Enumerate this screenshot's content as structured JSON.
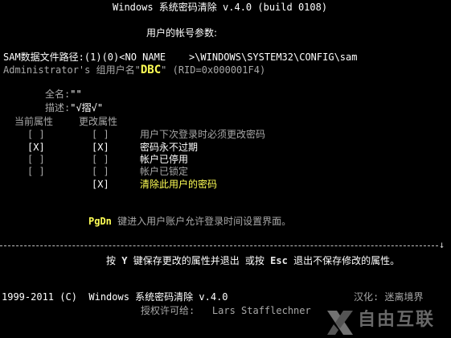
{
  "header": {
    "title": "Windows 系统密码清除 v.4.0 (build 0108)",
    "subtitle": "用户的帐号参数:"
  },
  "sam": {
    "label": "SAM数据文件路径:",
    "value": "(1)(0)<NO NAME    >\\WINDOWS\\SYSTEM32\\CONFIG\\sam"
  },
  "user": {
    "account": "Administrator's",
    "group_label": "组用户名\"",
    "group_name": "DBC",
    "rid": "\" (RID=0x000001F4)"
  },
  "fields": {
    "fullname_label": "全名:",
    "fullname_value": "\"\"",
    "desc_label": "描述:",
    "desc_value": "\"√摺√\""
  },
  "columns": {
    "current": "当前属性",
    "change": "更改属性"
  },
  "attributes": [
    {
      "current": "[ ]",
      "change": "[ ]",
      "label": "用户下次登录时必须更改密码",
      "style": "gray"
    },
    {
      "current": "[X]",
      "change": "[X]",
      "label": "密码永不过期",
      "style": "white"
    },
    {
      "current": "[ ]",
      "change": "[ ]",
      "label": "帐户已停用",
      "style": "white"
    },
    {
      "current": "[ ]",
      "change": "[ ]",
      "label": "帐户已锁定",
      "style": "gray"
    },
    {
      "current": "",
      "change": "[X]",
      "label": "清除此用户的密码",
      "style": "yellow"
    }
  ],
  "pgdn": {
    "key": "PgDn",
    "text": " 键进入用户账户允许登录时间设置界面。"
  },
  "save": {
    "prefix": "按 ",
    "save_key": "Y",
    "middle": " 键保存更改的属性并退出 或按 ",
    "esc_key": "Esc",
    "suffix": " 退出不保存修改的属性。"
  },
  "footer": {
    "copyright": "1999-2011 (C)  Windows 系统密码清除 v.4.0",
    "localized": "汉化: 迷离境界",
    "license": "授权许可给:   Lars Stafflechner"
  },
  "watermark": {
    "text": "自由互联",
    "logo_icon": "x-logo-icon"
  }
}
